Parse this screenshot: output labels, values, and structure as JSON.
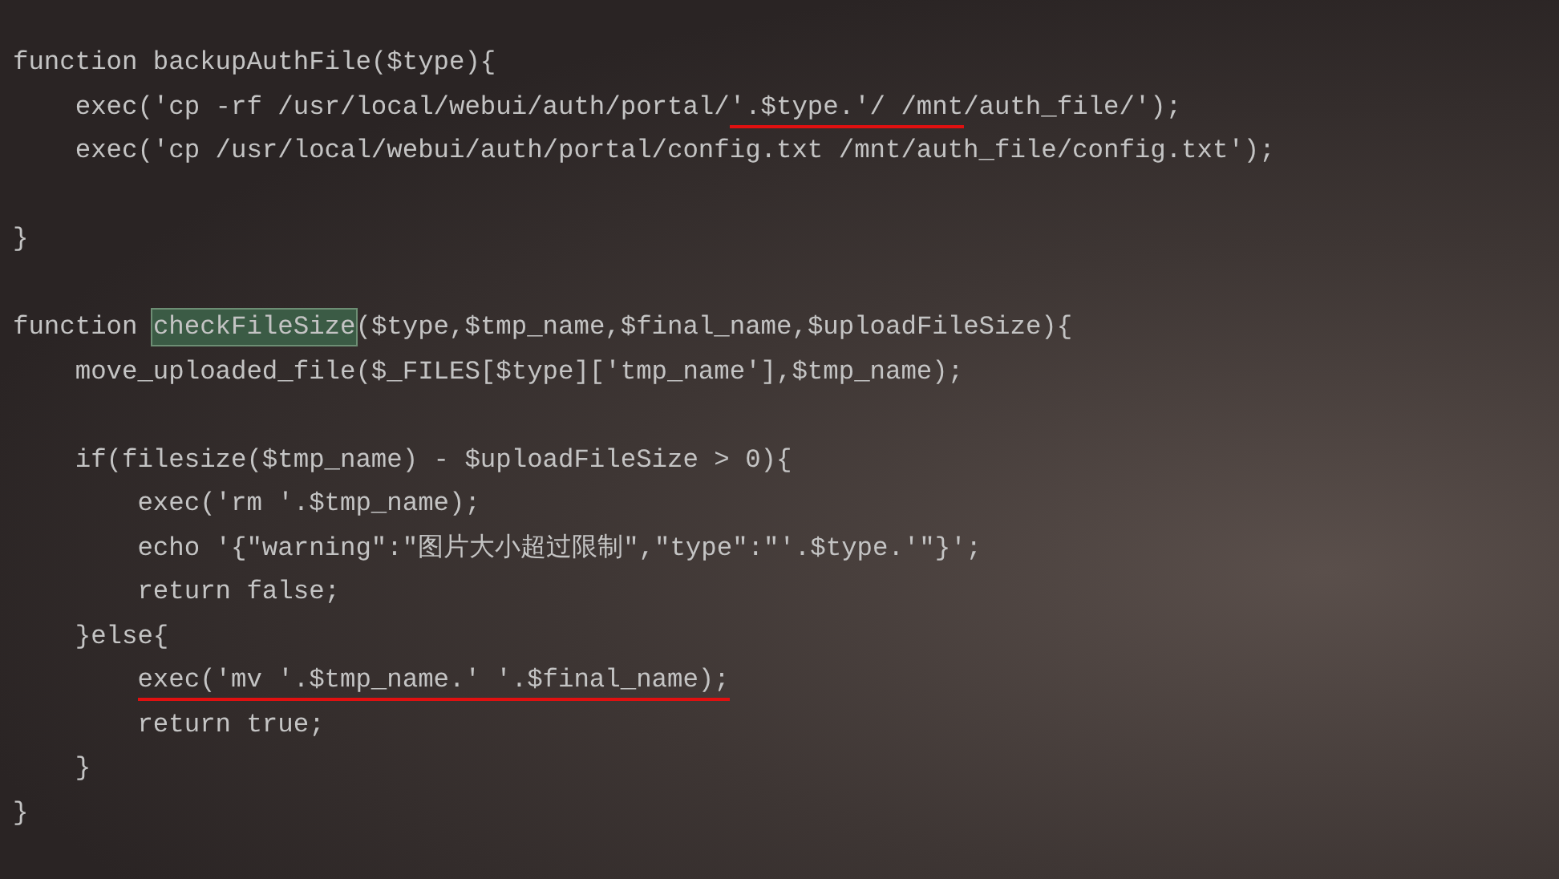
{
  "editor": {
    "lines": [
      {
        "kind": "code",
        "segments": [
          {
            "text": "function backupAuthFile($type){"
          }
        ]
      },
      {
        "kind": "code",
        "segments": [
          {
            "text": "    exec('cp -rf /usr/local/webui/auth/portal/"
          },
          {
            "text": "'.$type.'/ /mnt",
            "underlined": true
          },
          {
            "text": "/auth_file/');"
          }
        ]
      },
      {
        "kind": "code",
        "segments": [
          {
            "text": "    exec('cp /usr/local/webui/auth/portal/config.txt /mnt/auth_file/config.txt');"
          }
        ]
      },
      {
        "kind": "blank"
      },
      {
        "kind": "code",
        "segments": [
          {
            "text": "}"
          }
        ]
      },
      {
        "kind": "blank"
      },
      {
        "kind": "code",
        "segments": [
          {
            "text": "function "
          },
          {
            "text": "checkFileSize",
            "highlighted": true
          },
          {
            "text": "($type,$tmp_name,$final_name,$uploadFileSize){"
          }
        ]
      },
      {
        "kind": "code",
        "segments": [
          {
            "text": "    move_uploaded_file($_FILES[$type]['tmp_name'],$tmp_name);"
          }
        ]
      },
      {
        "kind": "blank"
      },
      {
        "kind": "code",
        "segments": [
          {
            "text": "    if(filesize($tmp_name) - $uploadFileSize > 0){"
          }
        ]
      },
      {
        "kind": "code",
        "segments": [
          {
            "text": "        exec('rm '.$tmp_name);"
          }
        ]
      },
      {
        "kind": "code",
        "segments": [
          {
            "text": "        echo '{\"warning\":\"图片大小超过限制\",\"type\":\"'.$type.'\"}';"
          }
        ]
      },
      {
        "kind": "code",
        "segments": [
          {
            "text": "        return false;"
          }
        ]
      },
      {
        "kind": "code",
        "segments": [
          {
            "text": "    }else{"
          }
        ]
      },
      {
        "kind": "code",
        "segments": [
          {
            "text": "        exec('mv '.$tmp_name.' '.$final_name);",
            "underlined": true
          }
        ]
      },
      {
        "kind": "code",
        "segments": [
          {
            "text": "        return true;"
          }
        ]
      },
      {
        "kind": "code",
        "segments": [
          {
            "text": "    }"
          }
        ]
      },
      {
        "kind": "code",
        "segments": [
          {
            "text": "}"
          }
        ]
      }
    ]
  }
}
